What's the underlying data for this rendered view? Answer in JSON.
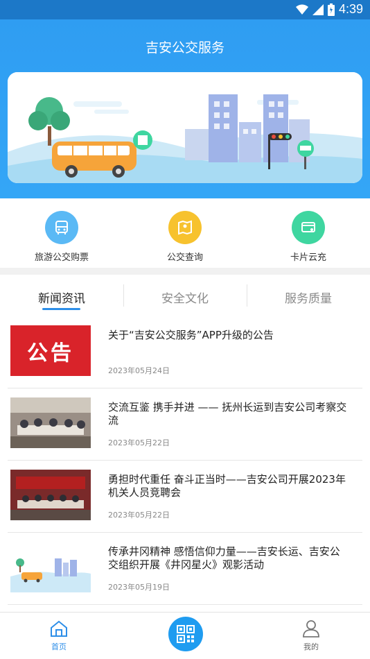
{
  "status_bar": {
    "time": "4:39"
  },
  "header": {
    "title": "吉安公交服务"
  },
  "quick_actions": [
    {
      "label": "旅游公交购票",
      "icon": "bus-icon",
      "color": "#5ab9f5"
    },
    {
      "label": "公交查询",
      "icon": "map-book-icon",
      "color": "#f7c22e"
    },
    {
      "label": "卡片云充",
      "icon": "card-recharge-icon",
      "color": "#3fd6a0"
    }
  ],
  "tabs": [
    {
      "label": "新闻资讯",
      "active": true
    },
    {
      "label": "安全文化",
      "active": false
    },
    {
      "label": "服务质量",
      "active": false
    }
  ],
  "news": [
    {
      "title": "关于“吉安公交服务”APP升级的公告",
      "date": "2023年05月24日",
      "thumb_text": "公告"
    },
    {
      "title": "交流互鉴 携手并进 —— 抚州长运到吉安公司考察交流",
      "date": "2023年05月22日"
    },
    {
      "title": "勇担时代重任 奋斗正当时——吉安公司开展2023年机关人员竞聘会",
      "date": "2023年05月22日"
    },
    {
      "title": "传承井冈精神 感悟信仰力量——吉安长运、吉安公交组织开展《井冈星火》观影活动",
      "date": "2023年05月19日"
    }
  ],
  "bottom_nav": {
    "home_label": "首页",
    "mine_label": "我的"
  },
  "colors": {
    "accent": "#2d8ee8",
    "header": "#34a6f6",
    "status_bar": "#1c78c8"
  }
}
